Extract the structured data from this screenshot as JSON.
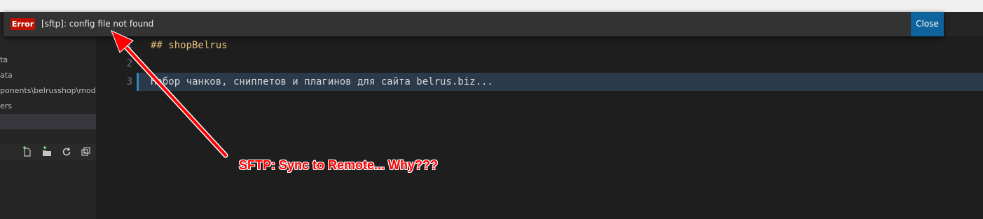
{
  "notification": {
    "badge": "Error",
    "message": "[sftp]: config file not found",
    "close_label": "Close"
  },
  "sidebar": {
    "items": [
      {
        "label": "ta"
      },
      {
        "label": "ata"
      },
      {
        "label": "ponents\\belrusshop\\mod..."
      },
      {
        "label": "ers"
      },
      {
        "label": ""
      }
    ],
    "toolbar_icons": [
      "new-file-icon",
      "new-folder-icon",
      "refresh-icon",
      "collapse-all-icon"
    ]
  },
  "editor": {
    "lines": [
      {
        "number": "1",
        "text": "## shopBelrus",
        "color": "#e5c07b"
      },
      {
        "number": "2",
        "text": "",
        "color": "#d4d4d4"
      },
      {
        "number": "3",
        "text": "Набор чанков, сниппетов и плагинов для сайта belrus.biz...",
        "color": "#d4d4d4"
      }
    ]
  },
  "annotation": {
    "text": "SFTP: Sync to Remote... Why???",
    "color": "#ff0000"
  }
}
